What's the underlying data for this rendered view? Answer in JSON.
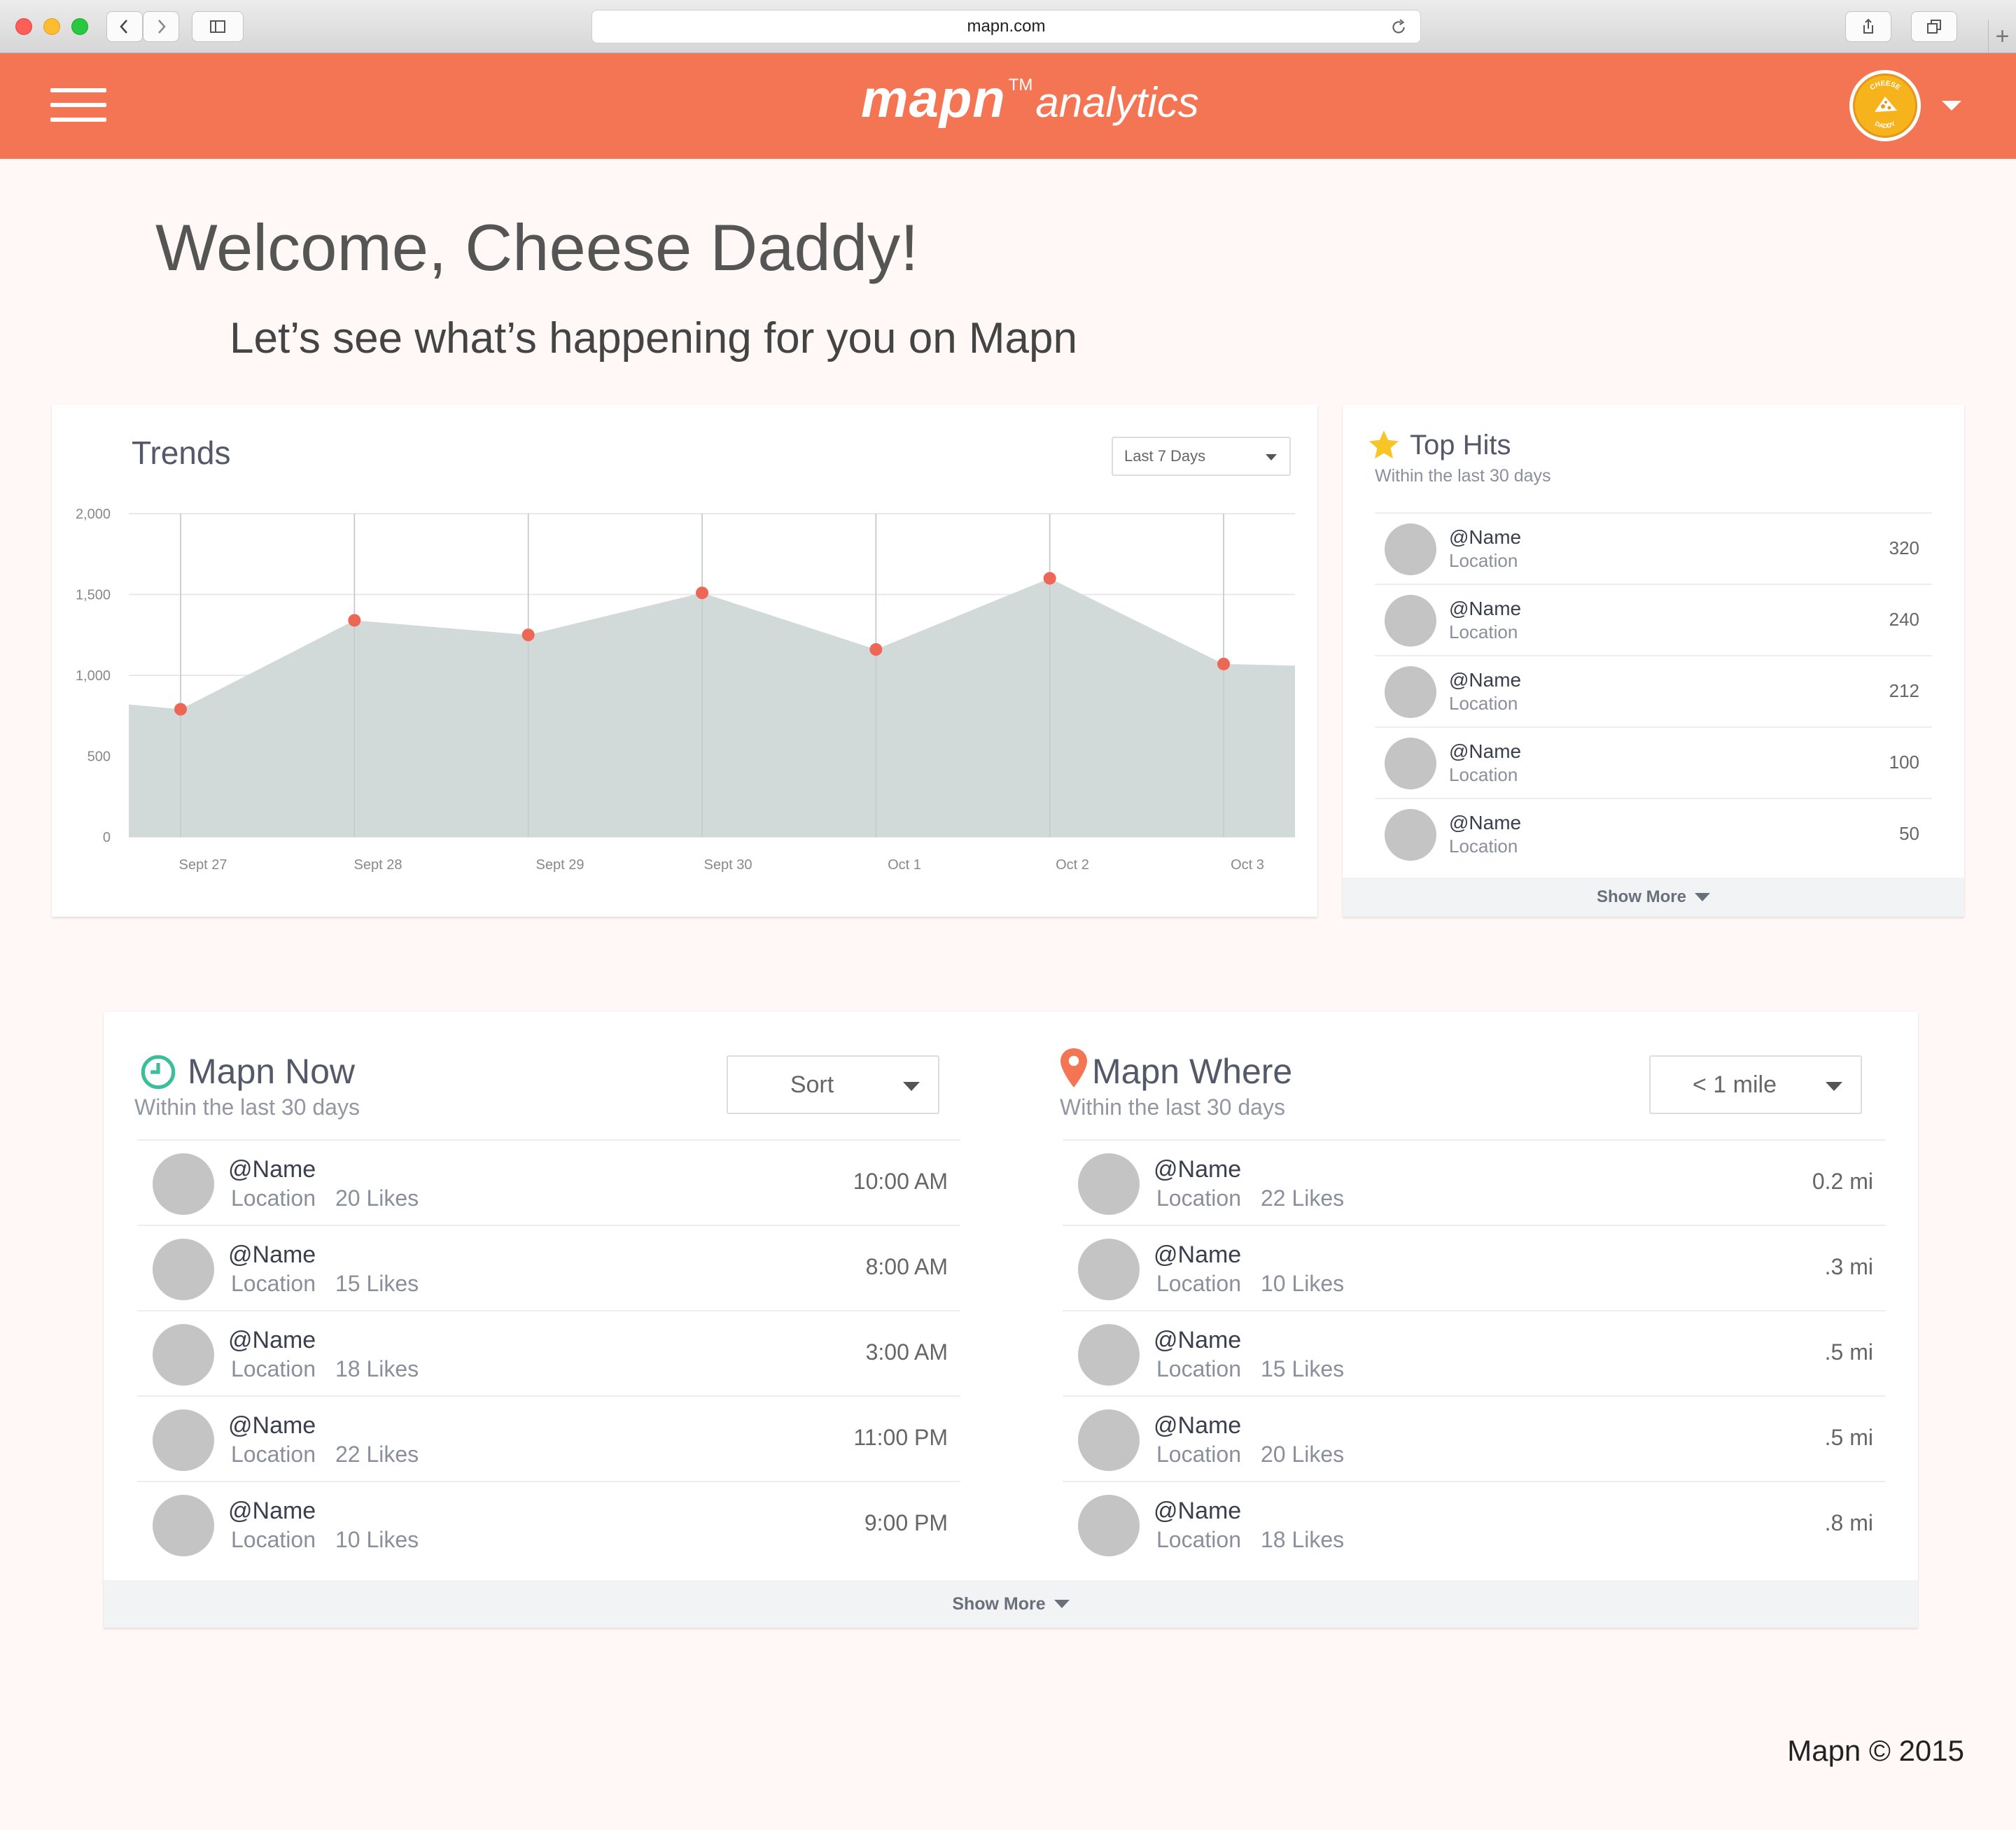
{
  "browser": {
    "url": "mapn.com"
  },
  "header": {
    "brand": "mapn",
    "trademark": "TM",
    "brand_sub": "analytics",
    "avatar_top": "CHEESE",
    "avatar_bottom": "DADDY"
  },
  "welcome": {
    "title": "Welcome, Cheese Daddy!",
    "tagline": "Let’s see what’s happening for you on Mapn"
  },
  "trends": {
    "title": "Trends",
    "range_select": "Last 7 Days"
  },
  "chart_data": {
    "type": "area",
    "title": "Trends",
    "categories": [
      "Sept 27",
      "Sept 28",
      "Sept 29",
      "Sept 30",
      "Oct 1",
      "Oct 2",
      "Oct 3"
    ],
    "series": [
      {
        "values": [
          790,
          1340,
          1250,
          1510,
          1160,
          1600,
          1070
        ]
      }
    ],
    "area_start_value": 820,
    "area_end_value": 1060,
    "ylim": [
      0,
      2000
    ],
    "yticks": [
      0,
      500,
      1000,
      1500,
      2000
    ],
    "ytick_labels": [
      "0",
      "500",
      "1,000",
      "1,500",
      "2,000"
    ],
    "grid": true,
    "colors": {
      "area": "#d2dad9",
      "point": "#ec6755",
      "grid": "#e8e8e8"
    }
  },
  "top_hits": {
    "title": "Top Hits",
    "subtitle": "Within the last 30 days",
    "show_more": "Show More",
    "items": [
      {
        "name": "@Name",
        "location": "Location",
        "value": "320"
      },
      {
        "name": "@Name",
        "location": "Location",
        "value": "240"
      },
      {
        "name": "@Name",
        "location": "Location",
        "value": "212"
      },
      {
        "name": "@Name",
        "location": "Location",
        "value": "100"
      },
      {
        "name": "@Name",
        "location": "Location",
        "value": "50"
      }
    ]
  },
  "mapn_now": {
    "title": "Mapn Now",
    "subtitle": "Within the last 30 days",
    "sort_label": "Sort",
    "items": [
      {
        "name": "@Name",
        "location": "Location",
        "likes": "20 Likes",
        "time": "10:00 AM"
      },
      {
        "name": "@Name",
        "location": "Location",
        "likes": "15 Likes",
        "time": "8:00 AM"
      },
      {
        "name": "@Name",
        "location": "Location",
        "likes": "18 Likes",
        "time": "3:00 AM"
      },
      {
        "name": "@Name",
        "location": "Location",
        "likes": "22 Likes",
        "time": "11:00 PM"
      },
      {
        "name": "@Name",
        "location": "Location",
        "likes": "10 Likes",
        "time": "9:00 PM"
      }
    ]
  },
  "mapn_where": {
    "title": "Mapn Where",
    "subtitle": "Within the last 30 days",
    "distance_label": "< 1 mile",
    "items": [
      {
        "name": "@Name",
        "location": "Location",
        "likes": "22 Likes",
        "distance": "0.2 mi"
      },
      {
        "name": "@Name",
        "location": "Location",
        "likes": "10 Likes",
        "distance": ".3 mi"
      },
      {
        "name": "@Name",
        "location": "Location",
        "likes": "15 Likes",
        "distance": ".5 mi"
      },
      {
        "name": "@Name",
        "location": "Location",
        "likes": "20 Likes",
        "distance": ".5 mi"
      },
      {
        "name": "@Name",
        "location": "Location",
        "likes": "18 Likes",
        "distance": ".8 mi"
      }
    ]
  },
  "bottom": {
    "show_more": "Show More"
  },
  "footer": {
    "copyright": "Mapn © 2015"
  },
  "colors": {
    "accent": "#f37554",
    "page_bg": "#fff8f6",
    "clock": "#3bbf9a",
    "pin": "#f37554",
    "star": "#f8c526"
  }
}
